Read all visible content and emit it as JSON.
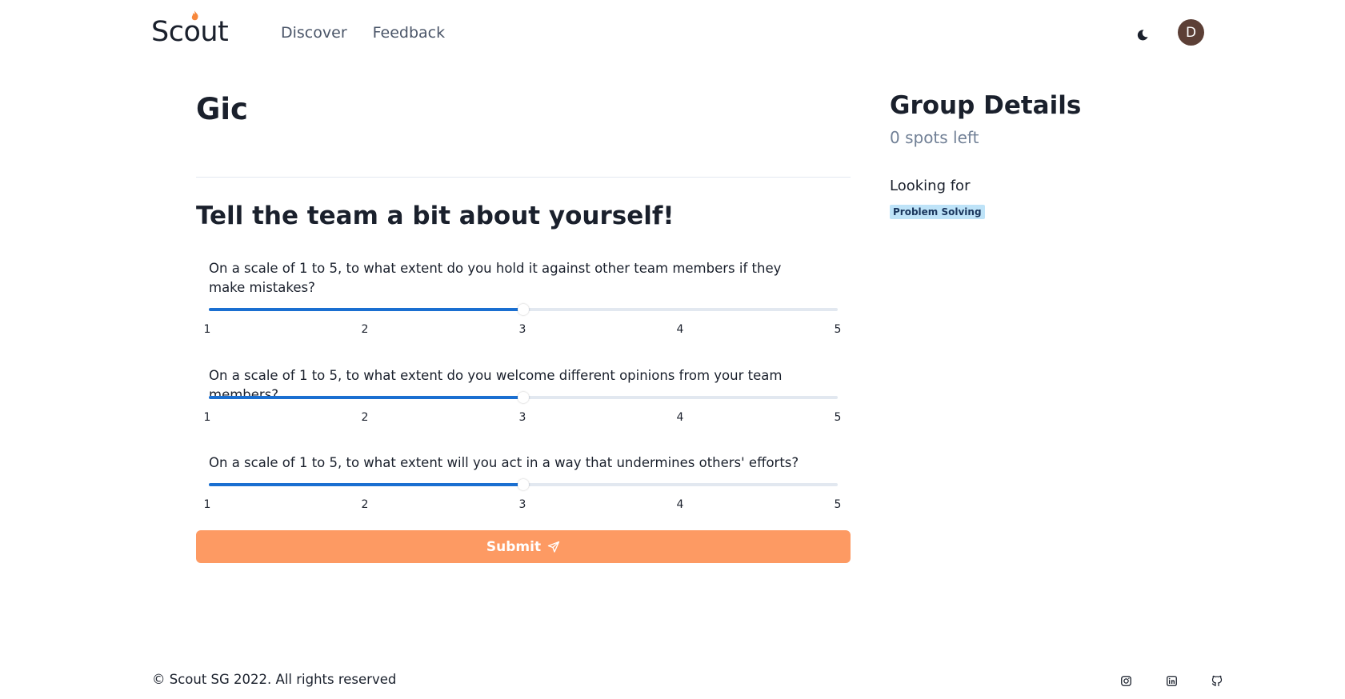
{
  "header": {
    "logo_text": "Scout",
    "nav": [
      {
        "label": "Discover"
      },
      {
        "label": "Feedback"
      }
    ],
    "avatar_initial": "D",
    "theme_toggle_icon": "moon-icon"
  },
  "main": {
    "title": "Gic",
    "form_heading": "Tell the team a bit about yourself!",
    "questions": [
      {
        "text": "On a scale of 1 to 5, to what extent do you hold it against other team members if they make mistakes?",
        "value": 3,
        "min": 1,
        "max": 5
      },
      {
        "text": "On a scale of 1 to 5, to what extent do you welcome different opinions from your team members?",
        "value": 3,
        "min": 1,
        "max": 5
      },
      {
        "text": "On a scale of 1 to 5, to what extent will you act in a way that undermines others' efforts?",
        "value": 3,
        "min": 1,
        "max": 5
      }
    ],
    "ticks": [
      "1",
      "2",
      "3",
      "4",
      "5"
    ],
    "submit_label": "Submit",
    "submit_icon": "send-icon"
  },
  "sidebar": {
    "title": "Group Details",
    "spots_left": "0 spots left",
    "looking_for_label": "Looking for",
    "skills": [
      "Problem Solving"
    ]
  },
  "footer": {
    "copyright": "© Scout SG 2022. All rights reserved",
    "social_icons": [
      "instagram-icon",
      "linkedin-icon",
      "github-icon"
    ]
  },
  "colors": {
    "accent": "#1a6fd1",
    "submit": "#fd9a63",
    "tag_bg": "#bee3f8",
    "avatar_bg": "#5c3f36"
  }
}
